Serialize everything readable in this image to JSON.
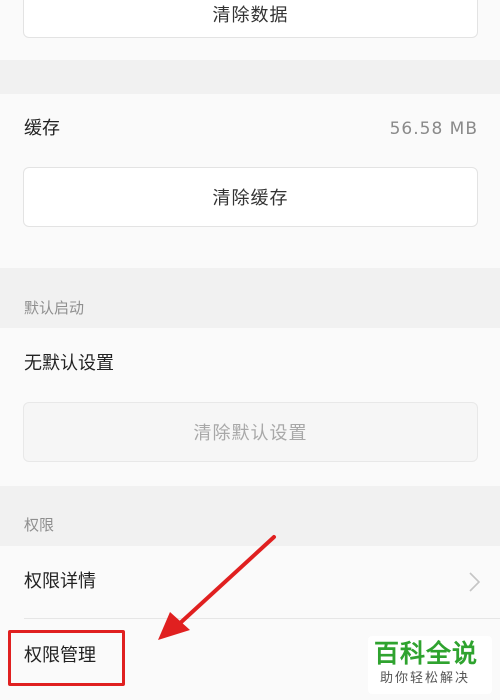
{
  "storage": {
    "clear_data_label": "清除数据",
    "cache_label": "缓存",
    "cache_size": "56.58 MB",
    "clear_cache_label": "清除缓存"
  },
  "default_launch": {
    "section_title": "默认启动",
    "status": "无默认设置",
    "clear_defaults_label": "清除默认设置"
  },
  "permissions": {
    "section_title": "权限",
    "details_label": "权限详情",
    "manage_label": "权限管理"
  },
  "watermark": {
    "main": "百科全说",
    "sub": "助你轻松解决"
  },
  "colors": {
    "annotation_red": "#e02020",
    "watermark_green": "#2fa32f"
  }
}
